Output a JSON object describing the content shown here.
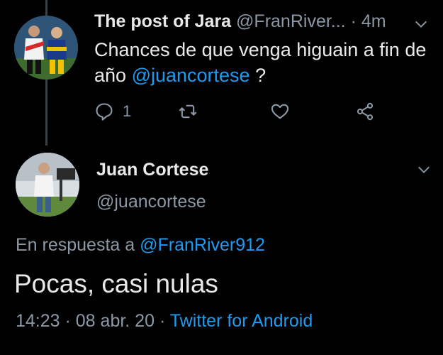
{
  "parent_tweet": {
    "author_name": "The post of Jara",
    "author_handle": "@FranRiver...",
    "separator": " · ",
    "time_ago": "4m",
    "text_before": "Chances de que venga higuain a fin de año ",
    "mention": "@juancortese",
    "text_after": " ?",
    "reply_count": "1"
  },
  "main_tweet": {
    "author_name": "Juan Cortese",
    "author_handle": "@juancortese",
    "reply_prefix": "En respuesta a ",
    "reply_to_handle": "@FranRiver912",
    "text": "Pocas, casi nulas",
    "time": "14:23",
    "date": "08 abr. 20",
    "dot": " · ",
    "source": "Twitter for Android"
  },
  "colors": {
    "background": "#000000",
    "text_primary": "#e7e9ea",
    "text_secondary": "#8b98a5",
    "accent": "#1d9bf0"
  },
  "icons": [
    "reply-icon",
    "retweet-icon",
    "like-icon",
    "share-icon",
    "chevron-down-icon"
  ]
}
